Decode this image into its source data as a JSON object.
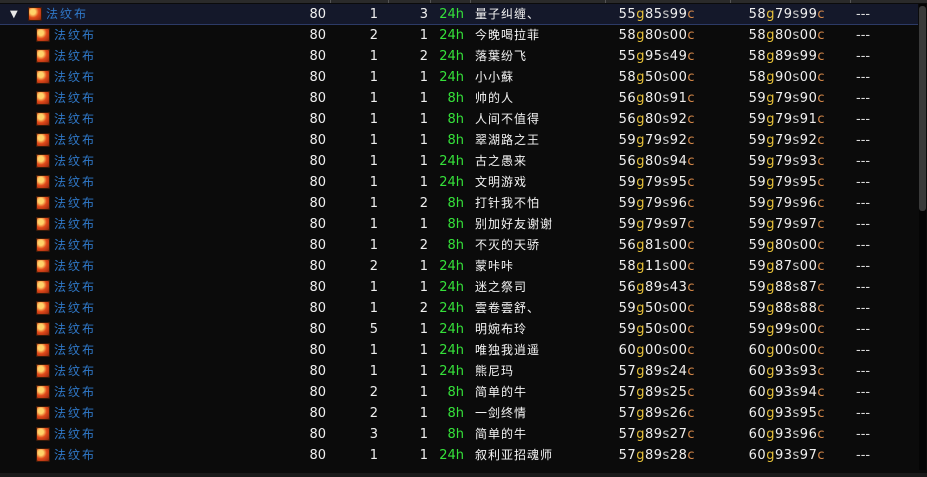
{
  "currency": {
    "gold": "g",
    "silver": "s",
    "copper": "c"
  },
  "icons": {
    "expand": "▼",
    "item": "cloth-bolt-icon"
  },
  "parent": {
    "name": "法纹布",
    "level": "80",
    "count": "1",
    "stack": "3",
    "time": "24h",
    "seller": "量子纠缠、",
    "bid": {
      "g": "55",
      "s": "85",
      "c": "99"
    },
    "buyout": {
      "g": "58",
      "s": "79",
      "c": "99"
    },
    "pct": "---"
  },
  "rows": [
    {
      "name": "法纹布",
      "level": "80",
      "count": "2",
      "stack": "1",
      "time": "24h",
      "seller": "今晚喝拉菲",
      "bid": {
        "g": "58",
        "s": "80",
        "c": "00"
      },
      "buyout": {
        "g": "58",
        "s": "80",
        "c": "00"
      },
      "pct": "---"
    },
    {
      "name": "法纹布",
      "level": "80",
      "count": "1",
      "stack": "2",
      "time": "24h",
      "seller": "落葉纷飞",
      "bid": {
        "g": "55",
        "s": "95",
        "c": "49"
      },
      "buyout": {
        "g": "58",
        "s": "89",
        "c": "99"
      },
      "pct": "---"
    },
    {
      "name": "法纹布",
      "level": "80",
      "count": "1",
      "stack": "1",
      "time": "24h",
      "seller": "小小蘇",
      "bid": {
        "g": "58",
        "s": "50",
        "c": "00"
      },
      "buyout": {
        "g": "58",
        "s": "90",
        "c": "00"
      },
      "pct": "---"
    },
    {
      "name": "法纹布",
      "level": "80",
      "count": "1",
      "stack": "1",
      "time": "8h",
      "seller": "帅的人",
      "bid": {
        "g": "56",
        "s": "80",
        "c": "91"
      },
      "buyout": {
        "g": "59",
        "s": "79",
        "c": "90"
      },
      "pct": "---"
    },
    {
      "name": "法纹布",
      "level": "80",
      "count": "1",
      "stack": "1",
      "time": "8h",
      "seller": "人间不值得",
      "bid": {
        "g": "56",
        "s": "80",
        "c": "92"
      },
      "buyout": {
        "g": "59",
        "s": "79",
        "c": "91"
      },
      "pct": "---"
    },
    {
      "name": "法纹布",
      "level": "80",
      "count": "1",
      "stack": "1",
      "time": "8h",
      "seller": "翠湖路之王",
      "bid": {
        "g": "59",
        "s": "79",
        "c": "92"
      },
      "buyout": {
        "g": "59",
        "s": "79",
        "c": "92"
      },
      "pct": "---"
    },
    {
      "name": "法纹布",
      "level": "80",
      "count": "1",
      "stack": "1",
      "time": "24h",
      "seller": "古之愚来",
      "bid": {
        "g": "56",
        "s": "80",
        "c": "94"
      },
      "buyout": {
        "g": "59",
        "s": "79",
        "c": "93"
      },
      "pct": "---"
    },
    {
      "name": "法纹布",
      "level": "80",
      "count": "1",
      "stack": "1",
      "time": "24h",
      "seller": "文明游戏",
      "bid": {
        "g": "59",
        "s": "79",
        "c": "95"
      },
      "buyout": {
        "g": "59",
        "s": "79",
        "c": "95"
      },
      "pct": "---"
    },
    {
      "name": "法纹布",
      "level": "80",
      "count": "1",
      "stack": "2",
      "time": "8h",
      "seller": "打针我不怕",
      "bid": {
        "g": "59",
        "s": "79",
        "c": "96"
      },
      "buyout": {
        "g": "59",
        "s": "79",
        "c": "96"
      },
      "pct": "---"
    },
    {
      "name": "法纹布",
      "level": "80",
      "count": "1",
      "stack": "1",
      "time": "8h",
      "seller": "别加好友谢谢",
      "bid": {
        "g": "59",
        "s": "79",
        "c": "97"
      },
      "buyout": {
        "g": "59",
        "s": "79",
        "c": "97"
      },
      "pct": "---"
    },
    {
      "name": "法纹布",
      "level": "80",
      "count": "1",
      "stack": "2",
      "time": "8h",
      "seller": "不灭的天骄",
      "bid": {
        "g": "56",
        "s": "81",
        "c": "00"
      },
      "buyout": {
        "g": "59",
        "s": "80",
        "c": "00"
      },
      "pct": "---"
    },
    {
      "name": "法纹布",
      "level": "80",
      "count": "2",
      "stack": "1",
      "time": "24h",
      "seller": "蒙咔咔",
      "bid": {
        "g": "58",
        "s": "11",
        "c": "00"
      },
      "buyout": {
        "g": "59",
        "s": "87",
        "c": "00"
      },
      "pct": "---"
    },
    {
      "name": "法纹布",
      "level": "80",
      "count": "1",
      "stack": "1",
      "time": "24h",
      "seller": "迷之祭司",
      "bid": {
        "g": "56",
        "s": "89",
        "c": "43"
      },
      "buyout": {
        "g": "59",
        "s": "88",
        "c": "87"
      },
      "pct": "---"
    },
    {
      "name": "法纹布",
      "level": "80",
      "count": "1",
      "stack": "2",
      "time": "24h",
      "seller": "雲卷雲舒、",
      "bid": {
        "g": "59",
        "s": "50",
        "c": "00"
      },
      "buyout": {
        "g": "59",
        "s": "88",
        "c": "88"
      },
      "pct": "---"
    },
    {
      "name": "法纹布",
      "level": "80",
      "count": "5",
      "stack": "1",
      "time": "24h",
      "seller": "明婉布玲",
      "bid": {
        "g": "59",
        "s": "50",
        "c": "00"
      },
      "buyout": {
        "g": "59",
        "s": "99",
        "c": "00"
      },
      "pct": "---"
    },
    {
      "name": "法纹布",
      "level": "80",
      "count": "1",
      "stack": "1",
      "time": "24h",
      "seller": "唯独我逍遥",
      "bid": {
        "g": "60",
        "s": "00",
        "c": "00"
      },
      "buyout": {
        "g": "60",
        "s": "00",
        "c": "00"
      },
      "pct": "---"
    },
    {
      "name": "法纹布",
      "level": "80",
      "count": "1",
      "stack": "1",
      "time": "24h",
      "seller": "熊尼玛",
      "bid": {
        "g": "57",
        "s": "89",
        "c": "24"
      },
      "buyout": {
        "g": "60",
        "s": "93",
        "c": "93"
      },
      "pct": "---"
    },
    {
      "name": "法纹布",
      "level": "80",
      "count": "2",
      "stack": "1",
      "time": "8h",
      "seller": "简单的牛",
      "bid": {
        "g": "57",
        "s": "89",
        "c": "25"
      },
      "buyout": {
        "g": "60",
        "s": "93",
        "c": "94"
      },
      "pct": "---"
    },
    {
      "name": "法纹布",
      "level": "80",
      "count": "2",
      "stack": "1",
      "time": "8h",
      "seller": "一剑终情",
      "bid": {
        "g": "57",
        "s": "89",
        "c": "26"
      },
      "buyout": {
        "g": "60",
        "s": "93",
        "c": "95"
      },
      "pct": "---"
    },
    {
      "name": "法纹布",
      "level": "80",
      "count": "3",
      "stack": "1",
      "time": "8h",
      "seller": "简单的牛",
      "bid": {
        "g": "57",
        "s": "89",
        "c": "27"
      },
      "buyout": {
        "g": "60",
        "s": "93",
        "c": "96"
      },
      "pct": "---"
    },
    {
      "name": "法纹布",
      "level": "80",
      "count": "1",
      "stack": "1",
      "time": "24h",
      "seller": "叙利亚招魂师",
      "bid": {
        "g": "57",
        "s": "89",
        "c": "28"
      },
      "buyout": {
        "g": "60",
        "s": "93",
        "c": "97"
      },
      "pct": "---"
    }
  ]
}
